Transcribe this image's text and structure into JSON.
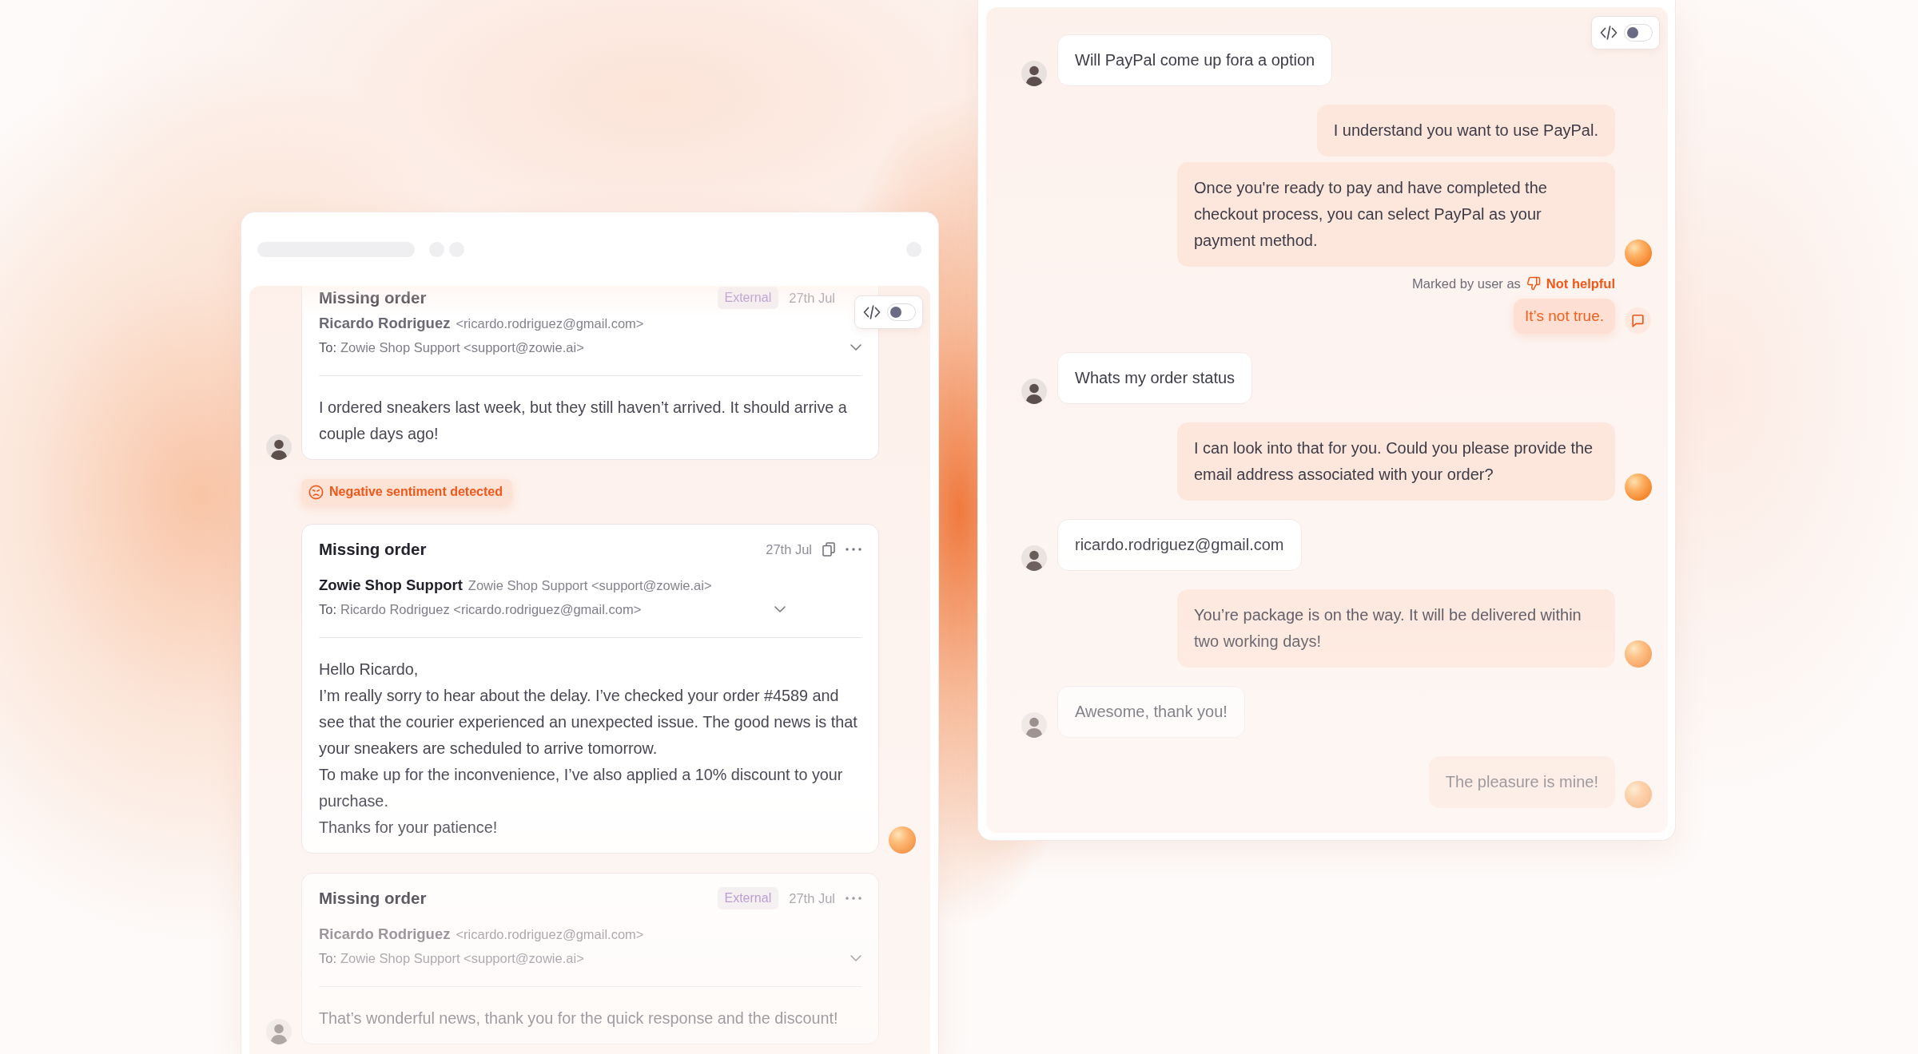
{
  "email_panel": {
    "code_toggle": {
      "on": false
    },
    "emails": [
      {
        "kind": "customer",
        "subject": "Missing order",
        "tag": "External",
        "date": "27th Jul",
        "sender_name": "Ricardo Rodriguez",
        "sender_address": "<ricardo.rodriguez@gmail.com>",
        "to_label": "To:",
        "to": "Zowie Shop Support <support@zowie.ai>",
        "body": [
          "I ordered sneakers last week, but they still haven’t arrived. It should arrive a couple days ago!"
        ],
        "alert": "Negative sentiment detected"
      },
      {
        "kind": "agent",
        "subject": "Missing order",
        "date": "27th Jul",
        "actions": [
          {
            "kind": "copy"
          },
          {
            "kind": "more"
          }
        ],
        "sender_name": "Zowie Shop Support",
        "sender_address": "Zowie Shop Support <support@zowie.ai>",
        "to_label": "To:",
        "to": "Ricardo Rodriguez <ricardo.rodriguez@gmail.com>",
        "body": [
          "Hello Ricardo,",
          "I’m really sorry to hear about the delay. I’ve checked your order #4589 and see that the courier experienced an unexpected issue. The good news is that your sneakers are scheduled to arrive tomorrow.",
          "To make up for the inconvenience, I’ve also applied a 10% discount to your purchase.",
          "Thanks for your patience!"
        ]
      },
      {
        "kind": "customer",
        "subject": "Missing order",
        "tag": "External",
        "date": "27th Jul",
        "actions": [
          {
            "kind": "more"
          }
        ],
        "sender_name": "Ricardo Rodriguez",
        "sender_address": "<ricardo.rodriguez@gmail.com>",
        "to_label": "To:",
        "to": "Zowie Shop Support <support@zowie.ai>",
        "body": [
          "That’s wonderful news, thank you for the quick response and the discount!"
        ]
      }
    ]
  },
  "chat_panel": {
    "code_toggle": {
      "on": false
    },
    "messages": [
      {
        "kind": "user",
        "text": "Will PayPal come up fora a option"
      },
      {
        "kind": "bot",
        "text": "I understand you want to use PayPal."
      },
      {
        "kind": "bot",
        "text": "Once you're ready to pay and have completed the checkout process, you can select PayPal as your payment method.",
        "feedback": {
          "label": "Marked by user as",
          "rating": "Not helpful",
          "comment": "It’s not true."
        }
      },
      {
        "kind": "user",
        "text": "Whats my order status"
      },
      {
        "kind": "bot",
        "text": "I can look into that for you. Could you please provide the email address associated with your order?"
      },
      {
        "kind": "user",
        "text": "ricardo.rodriguez@gmail.com"
      },
      {
        "kind": "bot",
        "text": "You’re package is on the way. It will be delivered within two working days!"
      },
      {
        "kind": "user",
        "text": "Awesome, thank you!"
      },
      {
        "kind": "bot",
        "text": "The pleasure is mine!"
      }
    ]
  }
}
